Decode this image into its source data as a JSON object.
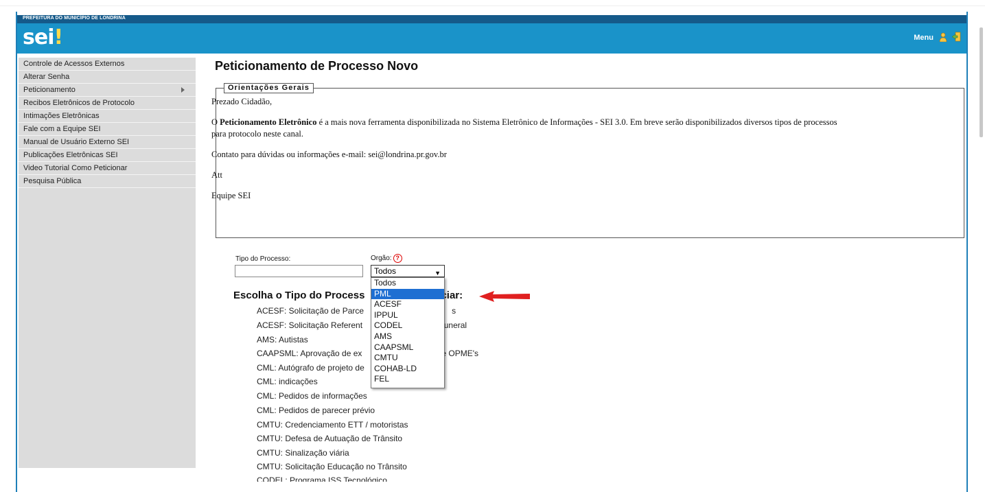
{
  "header": {
    "org_name": "PREFEITURA DO MUNICÍPIO DE LONDRINA",
    "logo_text": "sei",
    "logo_mark": "!",
    "menu_label": "Menu"
  },
  "sidebar": {
    "items": [
      {
        "label": "Controle de Acessos Externos"
      },
      {
        "label": "Alterar Senha"
      },
      {
        "label": "Peticionamento"
      },
      {
        "label": "Recibos Eletrônicos de Protocolo"
      },
      {
        "label": "Intimações Eletrônicas"
      },
      {
        "label": "Fale com a Equipe SEI"
      },
      {
        "label": "Manual de Usuário Externo SEI"
      },
      {
        "label": "Publicações Eletrônicas SEI"
      },
      {
        "label": "Video Tutorial Como Peticionar"
      },
      {
        "label": "Pesquisa Pública"
      }
    ]
  },
  "main": {
    "title": "Peticionamento de Processo Novo",
    "orientacoes": {
      "legend": "Orientações Gerais",
      "greeting": "Prezado Cidadão,",
      "para_bold": "Peticionamento Eletrônico",
      "para_prefix": "O ",
      "para_line1": " é a mais nova ferramenta disponibilizada no Sistema Eletrônico de Informações - SEI 3.0. Em breve serão disponibilizados diversos tipos de processos",
      "para_line2": "para protocolo neste canal.",
      "contact": "Contato para dúvidas ou informações e-mail: sei@londrina.pr.gov.br",
      "att": "Att",
      "team": "Equipe SEI"
    },
    "filters": {
      "tipo_label": "Tipo do Processo:",
      "tipo_value": "",
      "orgao_label": "Orgão:",
      "orgao_selected": "Todos",
      "help_glyph": "?"
    },
    "dropdown_options": [
      "Todos",
      "PML",
      "ACESF",
      "IPPUL",
      "CODEL",
      "AMS",
      "CAAPSML",
      "CMTU",
      "COHAB-LD",
      "FEL"
    ],
    "highlighted_option": "PML",
    "escolha_heading_a": "Escolha o Tipo do Process",
    "escolha_heading_b": "ciar:",
    "processes_visible": [
      "ACESF: Solicitação de Parce",
      "ACESF: Solicitação Referent",
      "AMS: Autistas",
      "CAAPSML: Aprovação de ex",
      "CML: Autógrafo de projeto de",
      "CML: indicações",
      "CML: Pedidos de informações",
      "CML: Pedidos de parecer prévio",
      "CMTU: Credenciamento ETT / motoristas",
      "CMTU: Defesa de Autuação de Trânsito",
      "CMTU: Sinalização viária",
      "CMTU: Solicitação Educação no Trânsito",
      "CODEL: Programa ISS Tecnológico"
    ],
    "process_tails": {
      "acesf_parce": "s",
      "acesf_referent": " Funeral",
      "caapsml": "e OPME's"
    }
  },
  "colors": {
    "topbar": "#155a8a",
    "bluebar": "#1a93c9",
    "sidebar": "#dcdcdc",
    "highlight": "#1e6fd2",
    "arrow": "#e02020"
  }
}
